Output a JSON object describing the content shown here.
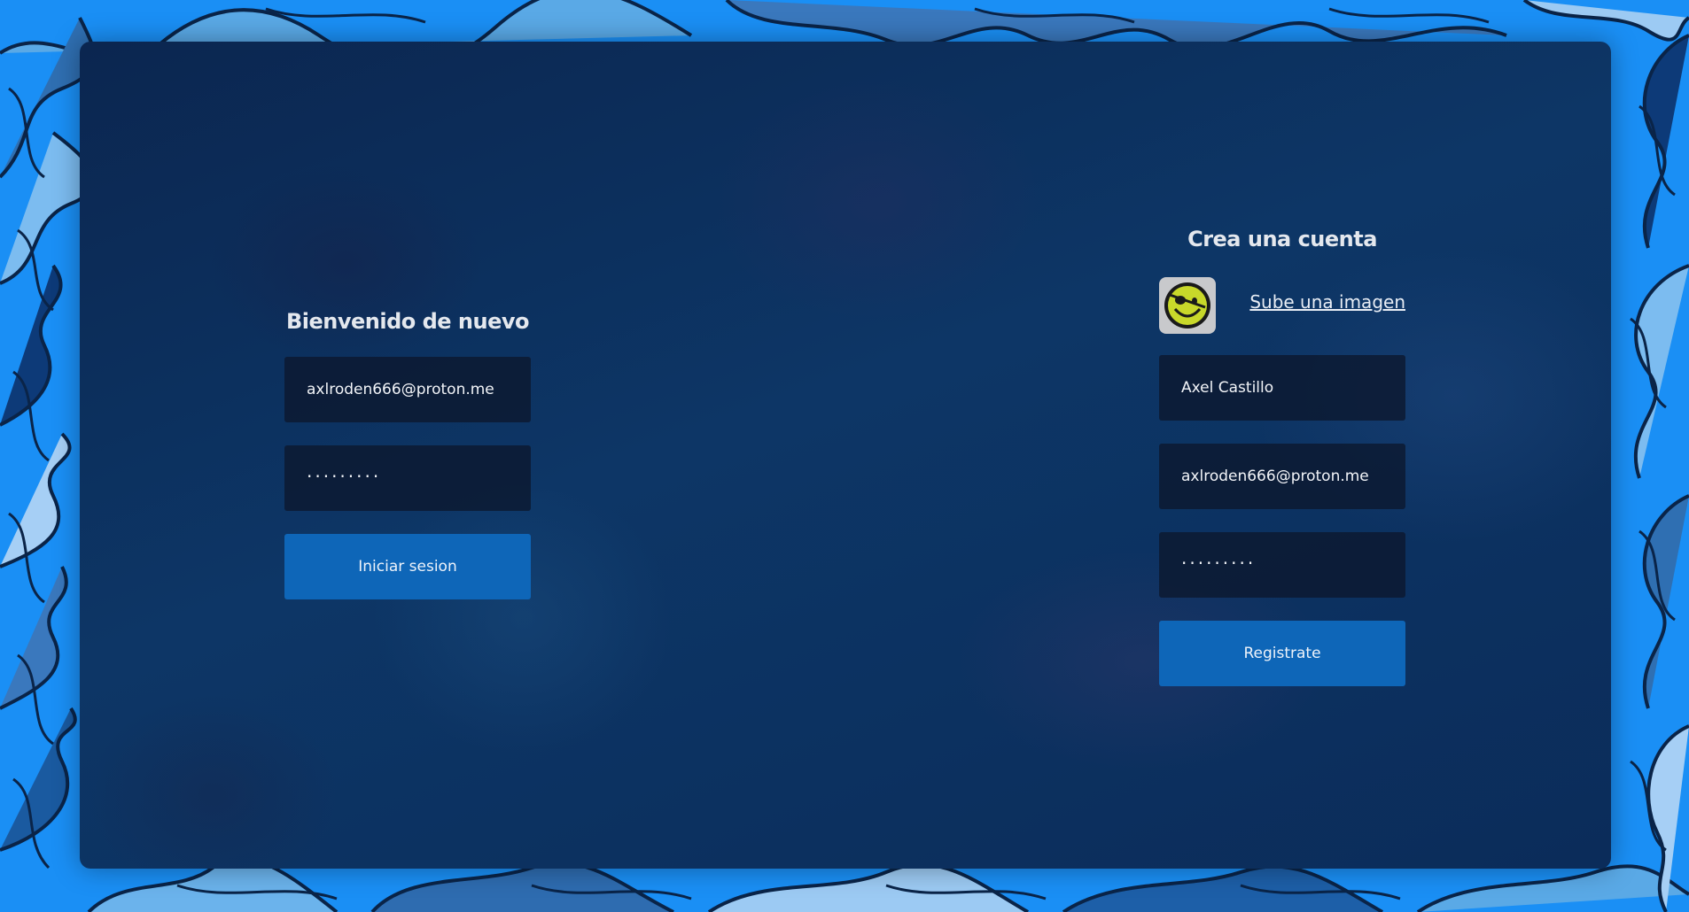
{
  "login": {
    "title": "Bienvenido de nuevo",
    "email_value": "axlroden666@proton.me",
    "password_mask": "·········",
    "submit_label": "Iniciar sesion"
  },
  "register": {
    "title": "Crea una cuenta",
    "avatar_icon": "smiley-eyepatch-icon",
    "upload_link": "Sube una imagen",
    "name_value": "Axel Castillo",
    "email_value": "axlroden666@proton.me",
    "password_mask": "·········",
    "submit_label": "Registrate"
  },
  "colors": {
    "background": "#1a8ff5",
    "panel": "#0b2c5a",
    "button": "#0e66b8",
    "field": "#0c1830"
  }
}
